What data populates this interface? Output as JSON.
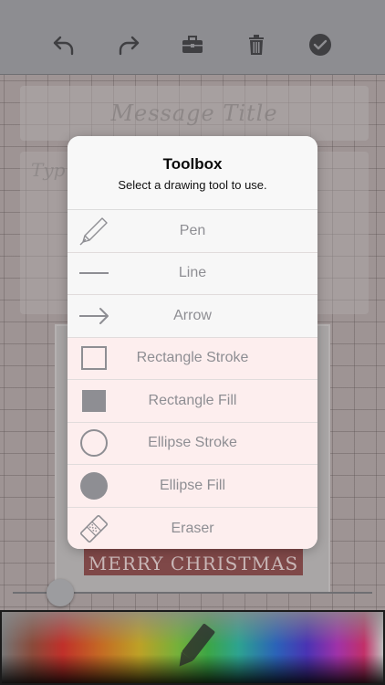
{
  "toolbar": {
    "undo": "undo-icon",
    "redo": "redo-icon",
    "toolbox": "toolbox-icon",
    "trash": "trash-icon",
    "done": "checkmark-icon"
  },
  "canvas": {
    "message_title": "Message Title",
    "message_body_placeholder": "Typ",
    "photo_banner_text": "MERRY CHRISTMAS"
  },
  "popover": {
    "title": "Toolbox",
    "subtitle": "Select a drawing tool to use.",
    "tools": [
      {
        "label": "Pen",
        "icon": "pen-icon"
      },
      {
        "label": "Line",
        "icon": "line-icon"
      },
      {
        "label": "Arrow",
        "icon": "arrow-icon"
      },
      {
        "label": "Rectangle Stroke",
        "icon": "rectangle-stroke-icon"
      },
      {
        "label": "Rectangle Fill",
        "icon": "rectangle-fill-icon"
      },
      {
        "label": "Ellipse Stroke",
        "icon": "ellipse-stroke-icon"
      },
      {
        "label": "Ellipse Fill",
        "icon": "ellipse-fill-icon"
      },
      {
        "label": "Eraser",
        "icon": "eraser-icon"
      }
    ]
  },
  "colors": {
    "icon_gray": "#8e8e93",
    "popover_bg": "#f7f7f7",
    "toolbar_icon": "#3f3f42"
  }
}
